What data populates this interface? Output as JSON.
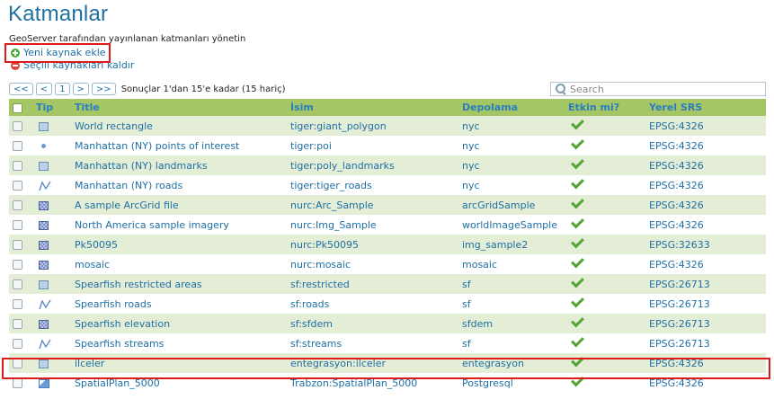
{
  "page": {
    "title": "Katmanlar",
    "subtitle": "GeoServer tarafından yayınlanan katmanları yönetin",
    "add_label": "Yeni kaynak ekle",
    "remove_label": "Seçili kaynakları kaldır"
  },
  "pager": {
    "first": "<<",
    "prev": "<",
    "page": "1",
    "next": ">",
    "last": ">>",
    "summary": "Sonuçlar 1'dan 15'e kadar (15 hariç)"
  },
  "search": {
    "placeholder": "Search"
  },
  "table": {
    "headers": {
      "type": "Tip",
      "title": "Title",
      "name": "İsim",
      "store": "Depolama",
      "enabled": "Etkin mi?",
      "srs": "Yerel SRS"
    },
    "rows": [
      {
        "icon": "polygon-icon",
        "title": "World rectangle",
        "name": "tiger:giant_polygon",
        "store": "nyc",
        "enabled": true,
        "srs": "EPSG:4326"
      },
      {
        "icon": "point-icon",
        "title": "Manhattan (NY) points of interest",
        "name": "tiger:poi",
        "store": "nyc",
        "enabled": true,
        "srs": "EPSG:4326"
      },
      {
        "icon": "polygon-icon",
        "title": "Manhattan (NY) landmarks",
        "name": "tiger:poly_landmarks",
        "store": "nyc",
        "enabled": true,
        "srs": "EPSG:4326"
      },
      {
        "icon": "line-icon",
        "title": "Manhattan (NY) roads",
        "name": "tiger:tiger_roads",
        "store": "nyc",
        "enabled": true,
        "srs": "EPSG:4326"
      },
      {
        "icon": "raster-icon",
        "title": "A sample ArcGrid file",
        "name": "nurc:Arc_Sample",
        "store": "arcGridSample",
        "enabled": true,
        "srs": "EPSG:4326"
      },
      {
        "icon": "raster-icon",
        "title": "North America sample imagery",
        "name": "nurc:Img_Sample",
        "store": "worldImageSample",
        "enabled": true,
        "srs": "EPSG:4326"
      },
      {
        "icon": "raster-icon",
        "title": "Pk50095",
        "name": "nurc:Pk50095",
        "store": "img_sample2",
        "enabled": true,
        "srs": "EPSG:32633"
      },
      {
        "icon": "raster-icon",
        "title": "mosaic",
        "name": "nurc:mosaic",
        "store": "mosaic",
        "enabled": true,
        "srs": "EPSG:4326"
      },
      {
        "icon": "polygon-icon",
        "title": "Spearfish restricted areas",
        "name": "sf:restricted",
        "store": "sf",
        "enabled": true,
        "srs": "EPSG:26713"
      },
      {
        "icon": "line-icon",
        "title": "Spearfish roads",
        "name": "sf:roads",
        "store": "sf",
        "enabled": true,
        "srs": "EPSG:26713"
      },
      {
        "icon": "raster-icon",
        "title": "Spearfish elevation",
        "name": "sf:sfdem",
        "store": "sfdem",
        "enabled": true,
        "srs": "EPSG:26713"
      },
      {
        "icon": "line-icon",
        "title": "Spearfish streams",
        "name": "sf:streams",
        "store": "sf",
        "enabled": true,
        "srs": "EPSG:26713"
      },
      {
        "icon": "polygon-icon",
        "title": "ilceler",
        "name": "entegrasyon:ilceler",
        "store": "entegrasyon",
        "enabled": true,
        "srs": "EPSG:4326"
      },
      {
        "icon": "layergroup-icon",
        "title": "SpatialPlan_5000",
        "name": "Trabzon:SpatialPlan_5000",
        "store": "Postgresql",
        "enabled": true,
        "srs": "EPSG:4326"
      }
    ]
  },
  "colors": {
    "header_bg": "#a4c664",
    "odd_row_bg": "#e4edd6",
    "link": "#1f6fa3",
    "highlight": "#e01919"
  }
}
